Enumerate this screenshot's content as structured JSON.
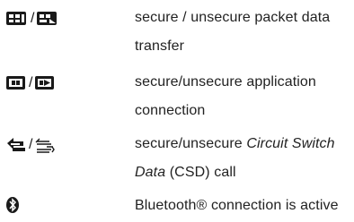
{
  "entries": [
    {
      "icon_left": "secure-packet-data-icon",
      "separator": "/",
      "icon_right": "unsecure-packet-data-icon",
      "line1": "secure / unsecure packet data",
      "line2": "transfer"
    },
    {
      "icon_left": "secure-application-connection-icon",
      "separator": "/",
      "icon_right": "unsecure-application-connection-icon",
      "line1": "secure/unsecure application",
      "line2": "connection"
    },
    {
      "icon_left": "secure-csd-call-icon",
      "separator": "/",
      "icon_right": "unsecure-csd-call-icon",
      "line1_pre": "secure/unsecure ",
      "line1_em": "Circuit Switch",
      "line2_em": "Data",
      "line2_post": " (CSD) call"
    },
    {
      "icon_left": "bluetooth-icon",
      "line1": "Bluetooth® connection is active"
    }
  ]
}
